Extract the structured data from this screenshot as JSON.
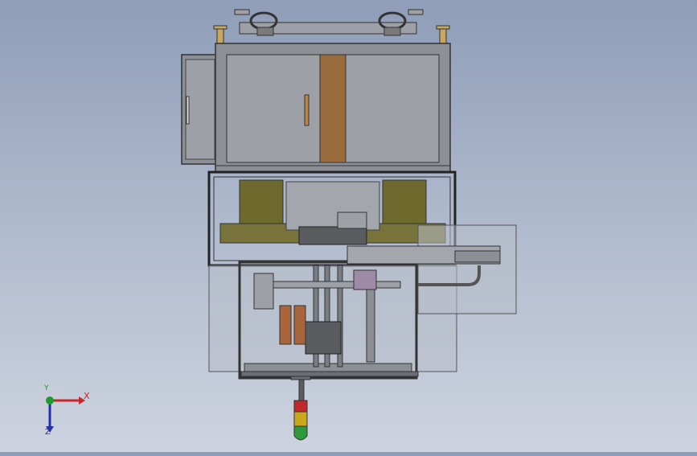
{
  "viewport": {
    "background_top": "#8f9db8",
    "background_bottom": "#cdd3df",
    "model_colors": {
      "frame": "#6b6e74",
      "cabinet": "#8c8f95",
      "door_panel": "#9da0a6",
      "wood_strip": "#9a6b3c",
      "olive_drum": "#6e6a2e",
      "glass": "#b8bdc8",
      "copper": "#a8643a",
      "tower_light_red": "#c0282a",
      "tower_light_yellow": "#c9a81e",
      "tower_light_green": "#2f9a3a"
    }
  },
  "triad": {
    "x_label": "X",
    "y_label": "Y",
    "z_label": "Z",
    "x_color": "#c8262a",
    "y_color": "#1f9a2d",
    "z_color": "#2430a8"
  }
}
